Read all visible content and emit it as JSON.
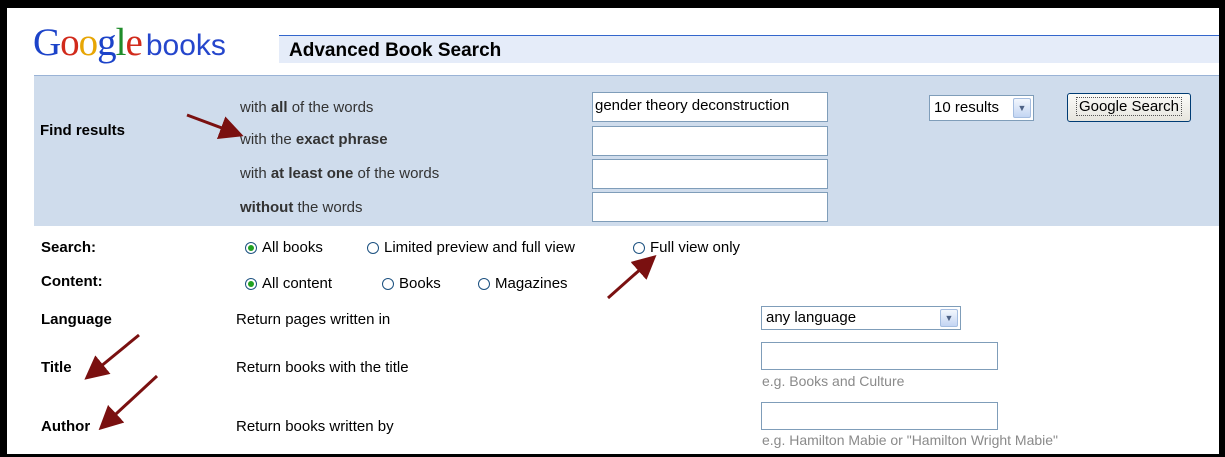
{
  "logo": {
    "letters": [
      {
        "ch": "G",
        "color": "#1c43c9"
      },
      {
        "ch": "o",
        "color": "#d12a1b"
      },
      {
        "ch": "o",
        "color": "#e7a605"
      },
      {
        "ch": "g",
        "color": "#1c43c9"
      },
      {
        "ch": "l",
        "color": "#1f8c2a"
      },
      {
        "ch": "e",
        "color": "#d12a1b"
      }
    ],
    "suffix": "books"
  },
  "page_title": "Advanced Book Search",
  "find": {
    "label": "Find results",
    "all_words": {
      "pre": "with ",
      "bold": "all",
      "post": " of the words",
      "value": "gender theory deconstruction"
    },
    "exact": {
      "pre": "with the ",
      "bold": "exact phrase",
      "post": "",
      "value": ""
    },
    "at_least": {
      "pre": "with ",
      "bold": "at least one",
      "post": " of the words",
      "value": ""
    },
    "without": {
      "pre": "",
      "bold": "without",
      "post": " the words",
      "value": ""
    },
    "results_select": "10 results",
    "search_button": "Google Search"
  },
  "search": {
    "label": "Search:",
    "options": [
      "All books",
      "Limited preview and full view",
      "Full view only"
    ],
    "selected": 0
  },
  "content": {
    "label": "Content:",
    "options": [
      "All content",
      "Books",
      "Magazines"
    ],
    "selected": 0
  },
  "language": {
    "label": "Language",
    "desc": "Return pages written in",
    "value": "any language"
  },
  "title": {
    "label": "Title",
    "desc": "Return books with the title",
    "value": "",
    "hint": "e.g. Books and Culture"
  },
  "author": {
    "label": "Author",
    "desc": "Return books written by",
    "value": "",
    "hint": "e.g. Hamilton Mabie or \"Hamilton Wright Mabie\""
  },
  "colors": {
    "accent_blue": "#3366cc",
    "find_bg": "#cfdcec",
    "title_bg": "#e5ecf9",
    "arrow": "#7a1010"
  }
}
